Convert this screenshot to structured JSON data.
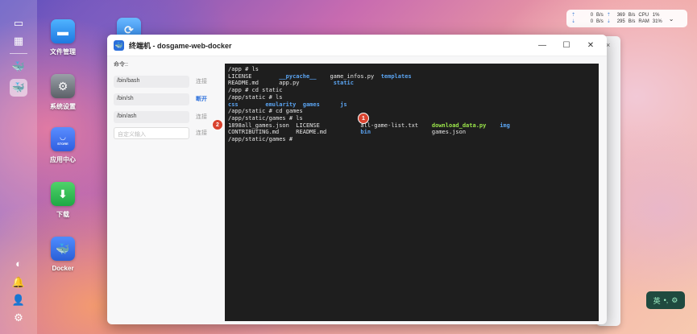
{
  "desktop": {
    "icons": [
      {
        "label": "文件管理",
        "icon": "folder-icon"
      },
      {
        "label": "系统设置",
        "icon": "gear-icon"
      },
      {
        "label": "应用中心",
        "icon": "store-icon",
        "badge": "STORE"
      },
      {
        "label": "下载",
        "icon": "download-icon"
      },
      {
        "label": "Docker",
        "icon": "docker-icon"
      }
    ]
  },
  "sysmon": {
    "up_value": "0",
    "up_unit": "B/s",
    "down_value": "0",
    "down_unit": "B/s",
    "up2_value": "369",
    "up2_unit": "B/s",
    "down2_value": "295",
    "down2_unit": "B/s",
    "cpu_label": "CPU",
    "cpu_value": "1%",
    "ram_label": "RAM",
    "ram_value": "31%"
  },
  "window": {
    "title": "终端机 - dosgame-web-docker",
    "commands_label": "命令::",
    "shells": [
      {
        "path": "/bin/bash",
        "action": "连接",
        "active": false
      },
      {
        "path": "/bin/sh",
        "action": "断开",
        "active": true
      },
      {
        "path": "/bin/ash",
        "action": "连接",
        "active": false
      }
    ],
    "custom_placeholder": "自定义输入",
    "custom_action": "连接"
  },
  "terminal": {
    "lines": [
      "/app # ls",
      "LICENSE",
      "README.md",
      "/app # cd static",
      "/app/static # ls",
      "css",
      "/app/static # cd games",
      "/app/static/games # ls",
      "1898all_games.json",
      "CONTRIBUTING.md",
      "/app/static/games # "
    ],
    "tokens": {
      "pycache": "__pycache__",
      "game_infos": "game_infos.py",
      "templates": "templates",
      "app_py": "app.py",
      "static": "static",
      "emularity": "emularity",
      "games": "games",
      "js": "js",
      "license2": "LICENSE",
      "readme2": "README.md",
      "all_game_list": "all-game-list.txt",
      "bin": "bin",
      "download_data": "download_data.py",
      "games_json": "games.json",
      "img": "img"
    }
  },
  "badges": {
    "one": "1",
    "two": "2"
  },
  "ime": {
    "label": "英"
  }
}
